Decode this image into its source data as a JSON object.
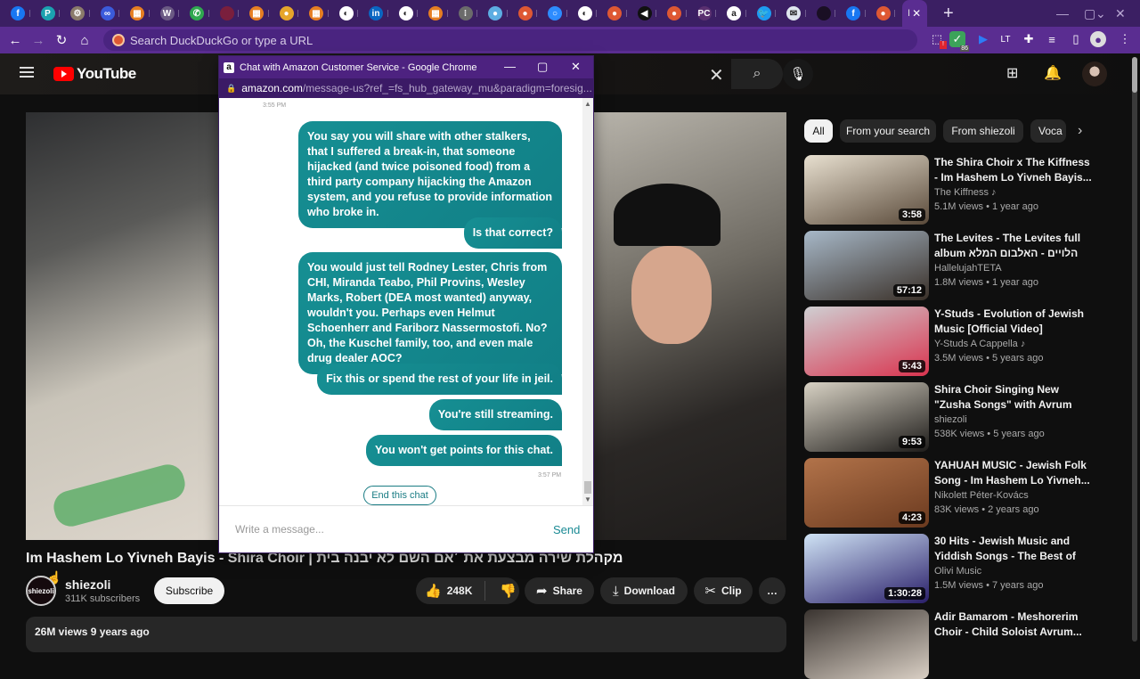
{
  "browser": {
    "tabs": [
      {
        "icon": "facebook-icon",
        "color": "#1877f2",
        "glyph": "f"
      },
      {
        "icon": "cloud-icon",
        "color": "#1ba1b0",
        "glyph": "P"
      },
      {
        "icon": "seal-icon",
        "color": "#8a7a6a",
        "glyph": "⚙"
      },
      {
        "icon": "meta-icon",
        "color": "#3b5bdb",
        "glyph": "∞"
      },
      {
        "icon": "app-icon",
        "color": "#e67e22",
        "glyph": "▦"
      },
      {
        "icon": "w-icon",
        "color": "#6b5a84",
        "glyph": "W"
      },
      {
        "icon": "phone-icon",
        "color": "#2fa84f",
        "glyph": "✆"
      },
      {
        "icon": "red-icon",
        "color": "#7a1f3d",
        "glyph": ""
      },
      {
        "icon": "app-icon",
        "color": "#e67e22",
        "glyph": "▦"
      },
      {
        "icon": "balloon-icon",
        "color": "#e6a52b",
        "glyph": "●"
      },
      {
        "icon": "app-icon",
        "color": "#e67e22",
        "glyph": "▦"
      },
      {
        "icon": "globe-icon",
        "color": "#ffffff",
        "glyph": "◐"
      },
      {
        "icon": "linkedin-icon",
        "color": "#0a66c2",
        "glyph": "in"
      },
      {
        "icon": "globe-icon",
        "color": "#ffffff",
        "glyph": "◐"
      },
      {
        "icon": "app-icon",
        "color": "#e67e22",
        "glyph": "▦"
      },
      {
        "icon": "grid-icon",
        "color": "#6b6b6b",
        "glyph": "⁝"
      },
      {
        "icon": "earth-icon",
        "color": "#5dade2",
        "glyph": "●"
      },
      {
        "icon": "duckduckgo-icon",
        "color": "#de5833",
        "glyph": "●"
      },
      {
        "icon": "ring-icon",
        "color": "#2d8cff",
        "glyph": "○"
      },
      {
        "icon": "globe-icon",
        "color": "#ffffff",
        "glyph": "◐"
      },
      {
        "icon": "duckduckgo-icon",
        "color": "#de5833",
        "glyph": "●"
      },
      {
        "icon": "arrow-icon",
        "color": "#111111",
        "glyph": "◀"
      },
      {
        "icon": "duckduckgo-icon",
        "color": "#de5833",
        "glyph": "●"
      },
      {
        "icon": "pc-icon",
        "color": "#5a3070",
        "glyph": "PC"
      },
      {
        "icon": "amazon-icon",
        "color": "#ffffff",
        "glyph": "a"
      },
      {
        "icon": "twitter-icon",
        "color": "#1d9bf0",
        "glyph": "🐦"
      },
      {
        "icon": "mail-icon",
        "color": "#dfe6ee",
        "glyph": "✉"
      },
      {
        "icon": "dark-icon",
        "color": "#1a0f24",
        "glyph": ""
      },
      {
        "icon": "facebook-icon",
        "color": "#1877f2",
        "glyph": "f"
      },
      {
        "icon": "duckduckgo-icon",
        "color": "#de5833",
        "glyph": "●"
      }
    ],
    "active_tab_label": "I",
    "new_tab": "+",
    "omnibox_placeholder": "Search DuckDuckGo or type a URL",
    "extension_badge": "86"
  },
  "youtube": {
    "logo_text": "YouTube",
    "video": {
      "title_en": "Im Hashem Lo Yivneh Bayis - Shira Choir | ",
      "title_he": "מקהלת שירה מבצעת את ׳אם השם לא יבנה בית",
      "channel": "shiezoli",
      "channel_avatar_text": "shiezoli",
      "subscribers": "311K subscribers",
      "subscribe_label": "Subscribe",
      "likes": "248K",
      "share_label": "Share",
      "download_label": "Download",
      "clip_label": "Clip",
      "more_label": "…",
      "views_date": "26M views  9 years ago"
    },
    "chips": [
      {
        "label": "All",
        "active": true
      },
      {
        "label": "From your search",
        "active": false
      },
      {
        "label": "From shiezoli",
        "active": false
      },
      {
        "label": "Voca",
        "active": false
      }
    ],
    "recommendations": [
      {
        "title": "The Shira Choir x The Kiffness - Im Hashem Lo Yivneh Bayis...",
        "channel": "The Kiffness ♪",
        "meta": "5.1M views  • 1 year ago",
        "duration": "3:58",
        "thumb": [
          "#e8e0d0",
          "#5a4a3a"
        ]
      },
      {
        "title": "The Levites - The Levites full album הלויים - האלבום המלא",
        "channel": "HallelujahTETA",
        "meta": "1.8M views  • 1 year ago",
        "duration": "57:12",
        "thumb": [
          "#a7b8c8",
          "#3a3028"
        ]
      },
      {
        "title": "Y-Studs - Evolution of Jewish Music [Official Video]",
        "channel": "Y-Studs A Cappella ♪",
        "meta": "3.5M views  • 5 years ago",
        "duration": "5:43",
        "thumb": [
          "#cfcfd2",
          "#d9344f"
        ]
      },
      {
        "title": "Shira Choir Singing New \"Zusha Songs\" with Avrum Mordche...",
        "channel": "shiezoli",
        "meta": "538K views  • 5 years ago",
        "duration": "9:53",
        "thumb": [
          "#d8d2c4",
          "#1e1c1a"
        ]
      },
      {
        "title": "YAHUAH MUSIC - Jewish Folk Song - Im Hashem Lo Yivneh...",
        "channel": "Nikolett Péter-Kovács",
        "meta": "83K views  • 2 years ago",
        "duration": "4:23",
        "thumb": [
          "#b2734a",
          "#6b3a1f"
        ]
      },
      {
        "title": "30 Hits - Jewish Music and Yiddish Songs - The Best of Th...",
        "channel": "Olivi Music",
        "meta": "1.5M views  • 7 years ago",
        "duration": "1:30:28",
        "thumb": [
          "#cfe3f5",
          "#2a1f6a"
        ]
      },
      {
        "title": "Adir Bamarom - Meshorerim Choir - Child Soloist Avrum...",
        "channel": "",
        "meta": "",
        "duration": "",
        "thumb": [
          "#3a3430",
          "#d9cfc4"
        ]
      }
    ]
  },
  "popup": {
    "window_title": "Chat with Amazon Customer Service - Google Chrome",
    "url_host": "amazon.com",
    "url_path": "/message-us?ref_=fs_hub_gateway_mu&paradigm=foresig...",
    "timestamp_top": "3:55 PM",
    "timestamp_bottom": "3:57 PM",
    "messages": [
      "You say you will share with other stalkers, that I suffered a break-in, that someone hijacked (and twice poisoned food) from a third party company hijacking the Amazon system, and you refuse to provide information who broke in.",
      "Is that correct?",
      "You would just tell Rodney Lester, Chris from CHI, Miranda Teabo, Phil Provins, Wesley Marks, Robert (DEA most wanted) anyway, wouldn't you. Perhaps even Helmut Schoenherr and Fariborz Nassermostofi. No? Oh, the Kuschel family, too, and even male drug dealer AOC?",
      "Fix this or spend the rest of your life in jeil.",
      "You're still streaming.",
      "You won't get points for this chat."
    ],
    "end_chat_label": "End this chat",
    "composer_placeholder": "Write a message...",
    "send_label": "Send"
  }
}
